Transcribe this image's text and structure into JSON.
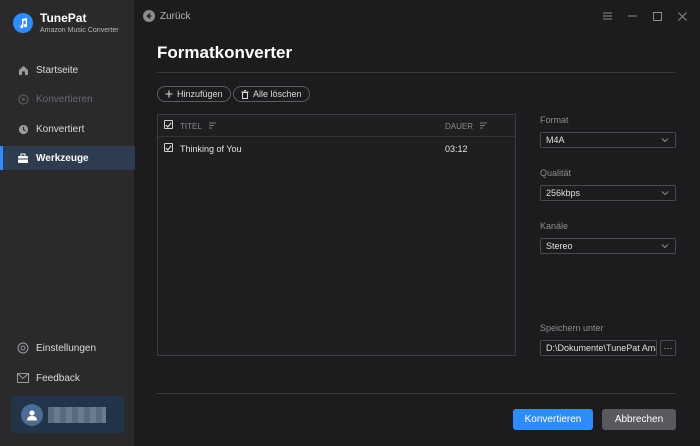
{
  "sidebar": {
    "brand_name": "TunePat",
    "brand_subtitle": "Amazon Music Converter",
    "items": [
      {
        "label": "Startseite",
        "icon": "home-icon",
        "state": "normal"
      },
      {
        "label": "Konvertieren",
        "icon": "convert-icon",
        "state": "disabled"
      },
      {
        "label": "Konvertiert",
        "icon": "clock-icon",
        "state": "normal"
      },
      {
        "label": "Werkzeuge",
        "icon": "toolbox-icon",
        "state": "active"
      },
      {
        "label": "Einstellungen",
        "icon": "settings-icon",
        "state": "normal"
      },
      {
        "label": "Feedback",
        "icon": "mail-icon",
        "state": "normal"
      }
    ]
  },
  "header": {
    "back_label": "Zurück",
    "title": "Formatkonverter"
  },
  "toolbar": {
    "add_label": "Hinzufügen",
    "clear_label": "Alle löschen"
  },
  "table": {
    "columns": [
      "TITEL",
      "DAUER"
    ],
    "rows": [
      {
        "title": "Thinking of You",
        "duration": "03:12",
        "checked": true
      }
    ]
  },
  "settings": {
    "format_label": "Format",
    "format_value": "M4A",
    "quality_label": "Qualität",
    "quality_value": "256kbps",
    "channels_label": "Kanäle",
    "channels_value": "Stereo",
    "save_label": "Speichern unter",
    "save_path": "D:\\Dokumente\\TunePat Amazon Music Converter"
  },
  "actions": {
    "convert_label": "Konvertieren",
    "cancel_label": "Abbrechen"
  },
  "colors": {
    "accent": "#2f8cff",
    "sidebar_bg": "#2a2a2d",
    "main_bg": "#1c1c1e"
  }
}
